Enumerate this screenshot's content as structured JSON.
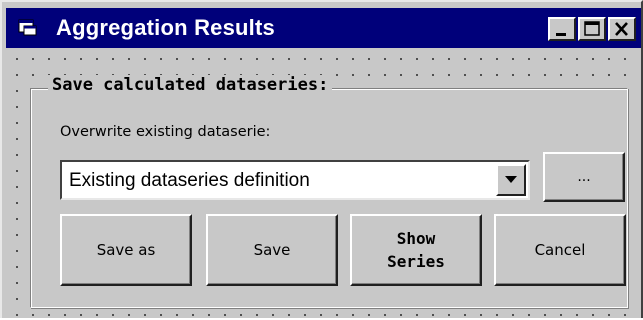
{
  "window": {
    "title": "Aggregation Results",
    "icon": "app-window-icon",
    "controls": [
      "minimize-icon",
      "maximize-icon",
      "close-icon"
    ]
  },
  "frame": {
    "label": "Save calculated dataseries:"
  },
  "overwrite": {
    "label": "Overwrite existing dataserie:",
    "selected_value": "Existing dataseries definition",
    "browse_label": "..."
  },
  "buttons": {
    "save_as": "Save as",
    "save": "Save",
    "show_series_line1": "Show",
    "show_series_line2": "Series",
    "cancel": "Cancel"
  },
  "colors": {
    "titlebar": "#00007a",
    "face": "#c8c8c8"
  }
}
